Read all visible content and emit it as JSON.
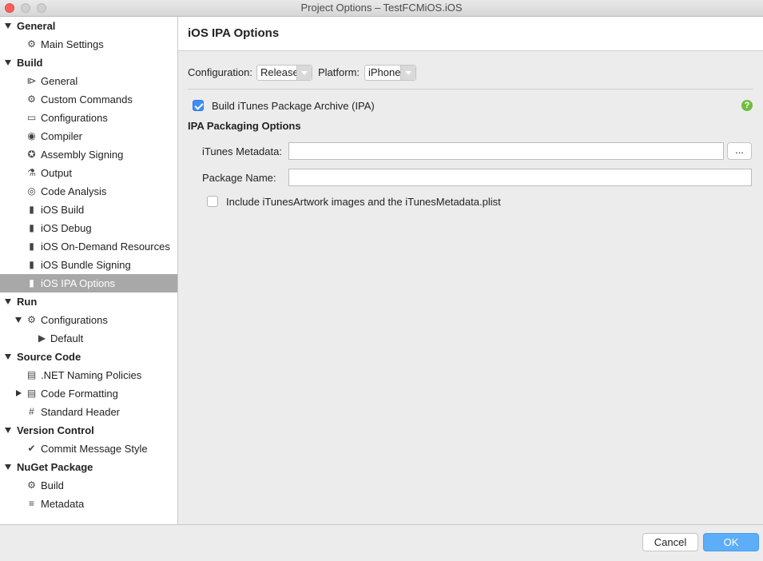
{
  "window": {
    "title": "Project Options – TestFCMiOS.iOS"
  },
  "sidebar": {
    "rows": [
      {
        "label": "General",
        "kind": "section",
        "expanded": true
      },
      {
        "label": "Main Settings",
        "icon": "gear-icon"
      },
      {
        "label": "Build",
        "kind": "section",
        "expanded": true
      },
      {
        "label": "General",
        "icon": "build-general-icon"
      },
      {
        "label": "Custom Commands",
        "icon": "gear-icon"
      },
      {
        "label": "Configurations",
        "icon": "window-icon"
      },
      {
        "label": "Compiler",
        "icon": "compiler-icon"
      },
      {
        "label": "Assembly Signing",
        "icon": "badge-icon"
      },
      {
        "label": "Output",
        "icon": "flask-icon"
      },
      {
        "label": "Code Analysis",
        "icon": "circle-dot-icon"
      },
      {
        "label": "iOS Build",
        "icon": "phone-icon"
      },
      {
        "label": "iOS Debug",
        "icon": "phone-icon"
      },
      {
        "label": "iOS On-Demand Resources",
        "icon": "phone-icon"
      },
      {
        "label": "iOS Bundle Signing",
        "icon": "phone-icon"
      },
      {
        "label": "iOS IPA Options",
        "icon": "phone-icon",
        "selected": true
      },
      {
        "label": "Run",
        "kind": "section",
        "expanded": true
      },
      {
        "label": "Configurations",
        "icon": "gear-icon",
        "expanded": true
      },
      {
        "label": "Default",
        "icon": "play-icon"
      },
      {
        "label": "Source Code",
        "kind": "section",
        "expanded": true
      },
      {
        "label": ".NET Naming Policies",
        "icon": "naming-icon"
      },
      {
        "label": "Code Formatting",
        "icon": "format-icon",
        "collapsed": true
      },
      {
        "label": "Standard Header",
        "icon": "hash-icon"
      },
      {
        "label": "Version Control",
        "kind": "section",
        "expanded": true
      },
      {
        "label": "Commit Message Style",
        "icon": "check-circle-icon"
      },
      {
        "label": "NuGet Package",
        "kind": "section",
        "expanded": true
      },
      {
        "label": "Build",
        "icon": "gear-icon"
      },
      {
        "label": "Metadata",
        "icon": "list-icon"
      }
    ]
  },
  "main": {
    "title": "iOS IPA Options",
    "configuration_label": "Configuration:",
    "configuration_value": "Release",
    "platform_label": "Platform:",
    "platform_value": "iPhone",
    "build_ipa_label": "Build iTunes Package Archive (IPA)",
    "build_ipa_checked": true,
    "help_glyph": "?",
    "packaging_heading": "IPA Packaging Options",
    "itunes_metadata_label": "iTunes Metadata:",
    "itunes_metadata_value": "",
    "browse_label": "...",
    "package_name_label": "Package Name:",
    "package_name_value": "",
    "include_artwork_label": "Include iTunesArtwork images and the iTunesMetadata.plist",
    "include_artwork_checked": false
  },
  "footer": {
    "cancel_label": "Cancel",
    "ok_label": "OK"
  }
}
